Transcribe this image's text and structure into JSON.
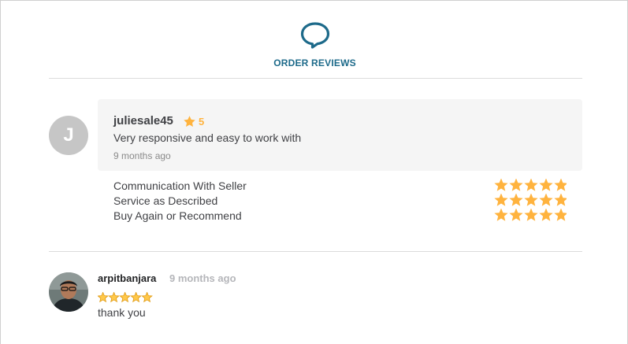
{
  "header": {
    "icon": "speech-bubble-icon",
    "title": "ORDER REVIEWS",
    "accent_color": "#1d6a8a"
  },
  "review_one": {
    "avatar_letter": "J",
    "reviewer": "juliesale45",
    "rating_icon": "star-icon",
    "rating": "5",
    "text": "Very responsive and easy to work with",
    "time": "9 months ago",
    "breakdown": [
      {
        "label": "Communication With Seller",
        "stars": 5
      },
      {
        "label": "Service as Described",
        "stars": 5
      },
      {
        "label": "Buy Again or Recommend",
        "stars": 5
      }
    ],
    "star_color": "#ffb33e"
  },
  "review_two": {
    "reviewer": "arpitbanjara",
    "time": "9 months ago",
    "stars": 5,
    "text": "thank you"
  }
}
